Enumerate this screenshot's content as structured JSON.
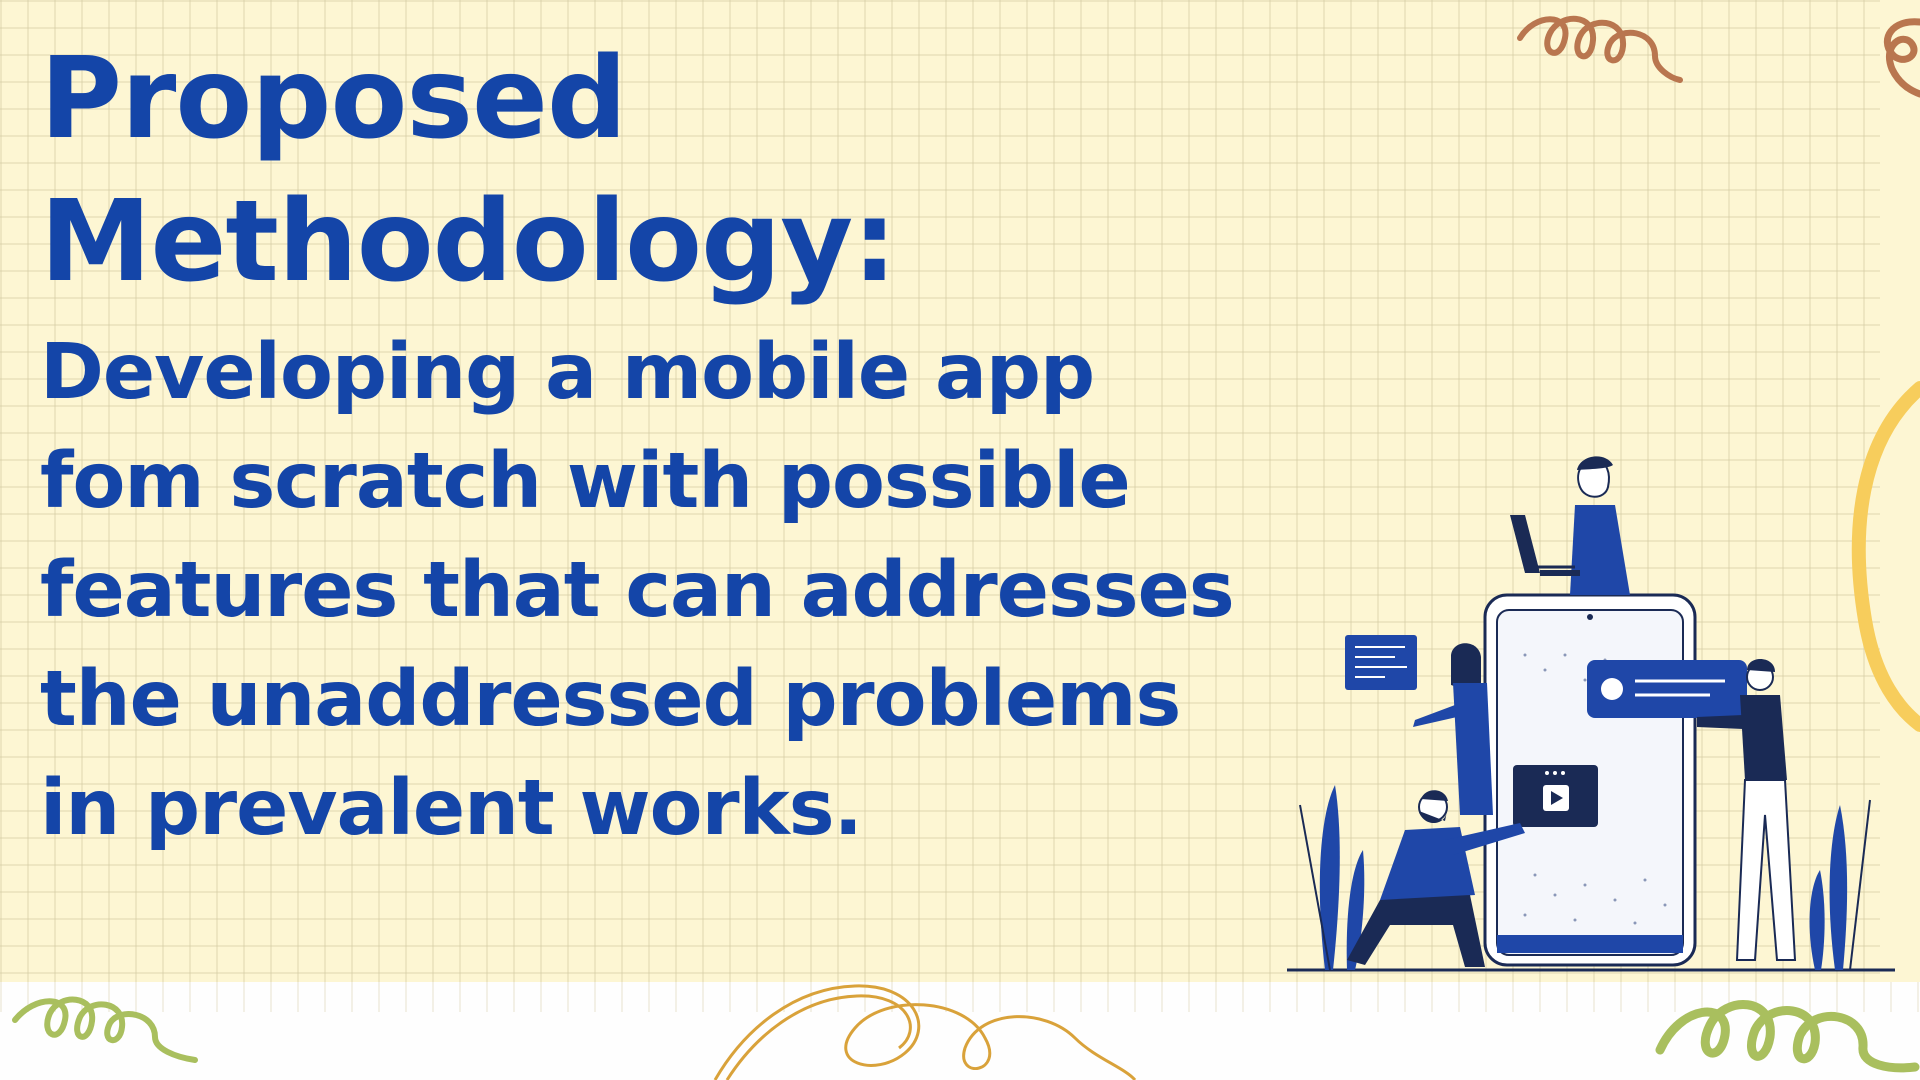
{
  "title": {
    "line1": "Proposed",
    "line2": "Methodology:"
  },
  "subtitle": {
    "line1": "Developing a mobile app",
    "line2": "fom scratch with possible",
    "line3": "features that can addresses",
    "line4": "the unaddressed problems",
    "line5": "in prevalent works."
  },
  "colors": {
    "background": "#fdf6d3",
    "text": "#1445a8",
    "squiggle_brown": "#b9764f",
    "squiggle_green": "#a9bf5e",
    "squiggle_orange": "#d9a23a",
    "arc_yellow": "#f7cd5c"
  },
  "illustration": {
    "subject": "team-building-mobile-app-illustration",
    "elements": [
      "phone-mockup",
      "person-with-laptop",
      "person-holding-card",
      "person-holding-message",
      "kneeling-person",
      "video-card",
      "plants"
    ]
  }
}
